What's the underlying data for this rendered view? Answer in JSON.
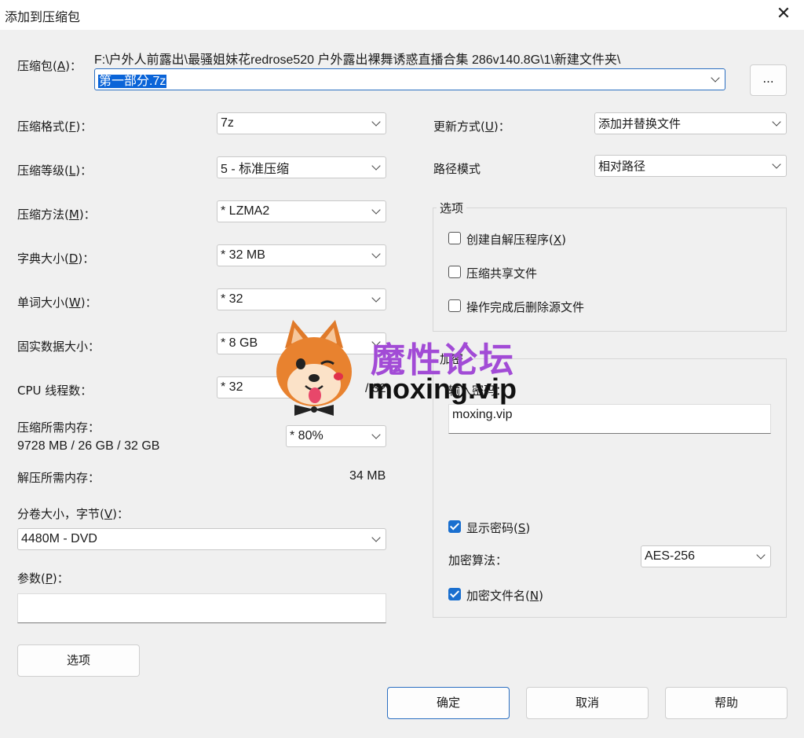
{
  "window": {
    "title": "添加到压缩包",
    "close_label": "✕"
  },
  "archive": {
    "label": "压缩包(A)：",
    "path": "F:\\户外人前露出\\最骚姐妹花redrose520 户外露出裸舞诱惑直播合集 286v140.8G\\1\\新建文件夹\\",
    "filename": "第一部分.7z",
    "browse_label": "..."
  },
  "left": {
    "format": {
      "label": "压缩格式(F)：",
      "value": "7z"
    },
    "level": {
      "label": "压缩等级(L)：",
      "value": "5 - 标准压缩"
    },
    "method": {
      "label": "压缩方法(M)：",
      "value": "*  LZMA2"
    },
    "dict": {
      "label": "字典大小(D)：",
      "value": "*  32 MB"
    },
    "word": {
      "label": "单词大小(W)：",
      "value": "*  32"
    },
    "solid": {
      "label": "固实数据大小：",
      "value": "*  8 GB"
    },
    "threads": {
      "label": "CPU 线程数：",
      "value": "*  32",
      "suffix": "/ 32"
    },
    "mem_comp": {
      "label": "压缩所需内存：",
      "detail": "9728 MB / 26 GB / 32 GB",
      "value": "*  80%"
    },
    "mem_decomp": {
      "label": "解压所需内存：",
      "value": "34 MB"
    },
    "volume": {
      "label": "分卷大小，字节(V)：",
      "value": "4480M - DVD"
    },
    "params": {
      "label": "参数(P)：",
      "value": ""
    },
    "options_button": "选项"
  },
  "right": {
    "update": {
      "label": "更新方式(U)：",
      "value": "添加并替换文件"
    },
    "pathmode": {
      "label": "路径模式",
      "value": "相对路径"
    },
    "options_group": "选项",
    "options": [
      {
        "label": "创建自解压程序(X)",
        "checked": false
      },
      {
        "label": "压缩共享文件",
        "checked": false
      },
      {
        "label": "操作完成后删除源文件",
        "checked": false
      }
    ],
    "encryption": {
      "group": "加密",
      "password_label": "输入密码：",
      "password": "moxing.vip",
      "show_password": "显示密码(S)",
      "algo_label": "加密算法：",
      "algo": "AES-256",
      "encrypt_names": "加密文件名(N)"
    }
  },
  "watermark": {
    "line1": "魔性论坛",
    "line2": "moxing.vip"
  },
  "buttons": {
    "ok": "确定",
    "cancel": "取消",
    "help": "帮助"
  },
  "colors": {
    "accent": "#1a6fcf",
    "selection": "#0a64d8",
    "watermark_purple": "#a24bd6",
    "watermark_red": "#e0304a"
  }
}
